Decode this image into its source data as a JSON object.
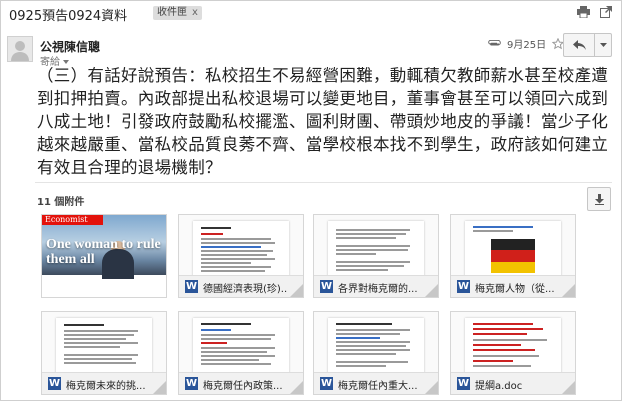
{
  "subject": "0925預告0924資料",
  "label": "收件匣",
  "label_remove": "x",
  "icons": {
    "print": "print-icon",
    "popout": "new-window-icon",
    "attach": "paperclip-icon",
    "star": "star-icon",
    "reply": "reply-icon",
    "more": "chevron-down-icon",
    "download": "download-icon"
  },
  "sender": "公視陳信聰",
  "to": "寄給",
  "date": "9月25日",
  "body": "（三）有話好說預告：私校招生不易經營困難，動輒積欠教師薪水甚至校產遭到扣押拍賣。內政部提出私校退場可以變更地目，董事會甚至可以領回六成到八成土地！引發政府鼓勵私校擺濫、圖利財團、帶頭炒地皮的爭議！當少子化越來越嚴重、當私校品質良莠不齊、當學校根本找不到學生，政府該如何建立有效且合理的退場機制？",
  "attachments_count": "11 個附件",
  "economist": {
    "logo": "Economist",
    "headline": "One woman to rule them all"
  },
  "attachments": [
    {
      "name": "",
      "badge": ""
    },
    {
      "name": "德國經濟表現(珍)...",
      "badge": "W"
    },
    {
      "name": "各界對梅克爾的...",
      "badge": "W"
    },
    {
      "name": "梅克爾人物（從...",
      "badge": "W"
    },
    {
      "name": "梅克爾未來的挑...",
      "badge": "W"
    },
    {
      "name": "梅克爾任內政策...",
      "badge": "W"
    },
    {
      "name": "梅克爾任內重大...",
      "badge": "W"
    },
    {
      "name": "提綱a.doc",
      "badge": "W"
    }
  ],
  "colors": {
    "word_blue": "#2a5599",
    "economist_red": "#e3120b"
  }
}
